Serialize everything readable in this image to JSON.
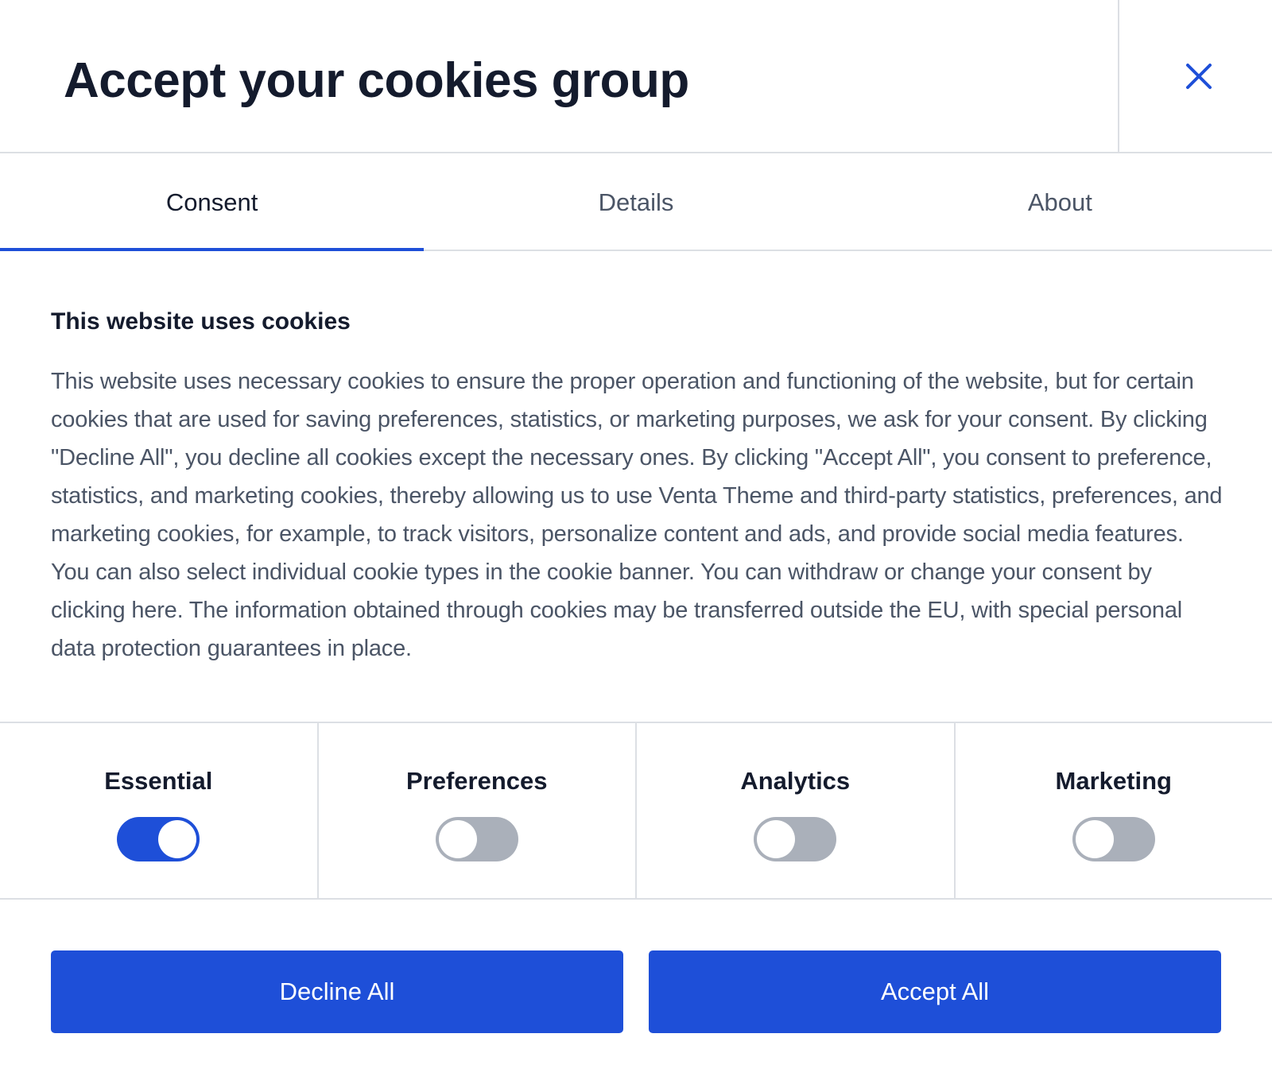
{
  "header": {
    "title": "Accept your cookies group",
    "close_icon": "close-icon"
  },
  "tabs": [
    {
      "label": "Consent",
      "active": true
    },
    {
      "label": "Details",
      "active": false
    },
    {
      "label": "About",
      "active": false
    }
  ],
  "consent": {
    "heading": "This website uses cookies",
    "body": "This website uses necessary cookies to ensure the proper operation and functioning of the website, but for certain cookies that are used for saving preferences, statistics, or marketing purposes, we ask for your consent. By clicking \"Decline All\", you decline all cookies except the necessary ones. By clicking \"Accept All\", you consent to preference, statistics, and marketing cookies, thereby allowing us to use Venta Theme and third-party statistics, preferences, and marketing cookies, for example, to track visitors, personalize content and ads, and provide social media features. You can also select individual cookie types in the cookie banner. You can withdraw or change your consent by clicking here. The information obtained through cookies may be transferred outside the EU, with special personal data protection guarantees in place."
  },
  "categories": [
    {
      "label": "Essential",
      "enabled": true
    },
    {
      "label": "Preferences",
      "enabled": false
    },
    {
      "label": "Analytics",
      "enabled": false
    },
    {
      "label": "Marketing",
      "enabled": false
    }
  ],
  "actions": {
    "decline_label": "Decline All",
    "accept_label": "Accept All"
  },
  "colors": {
    "accent": "#1e4fd8",
    "text": "#141b2d",
    "muted_text": "#4b5566",
    "toggle_off": "#aab0ba",
    "divider": "#dcdfe4"
  }
}
